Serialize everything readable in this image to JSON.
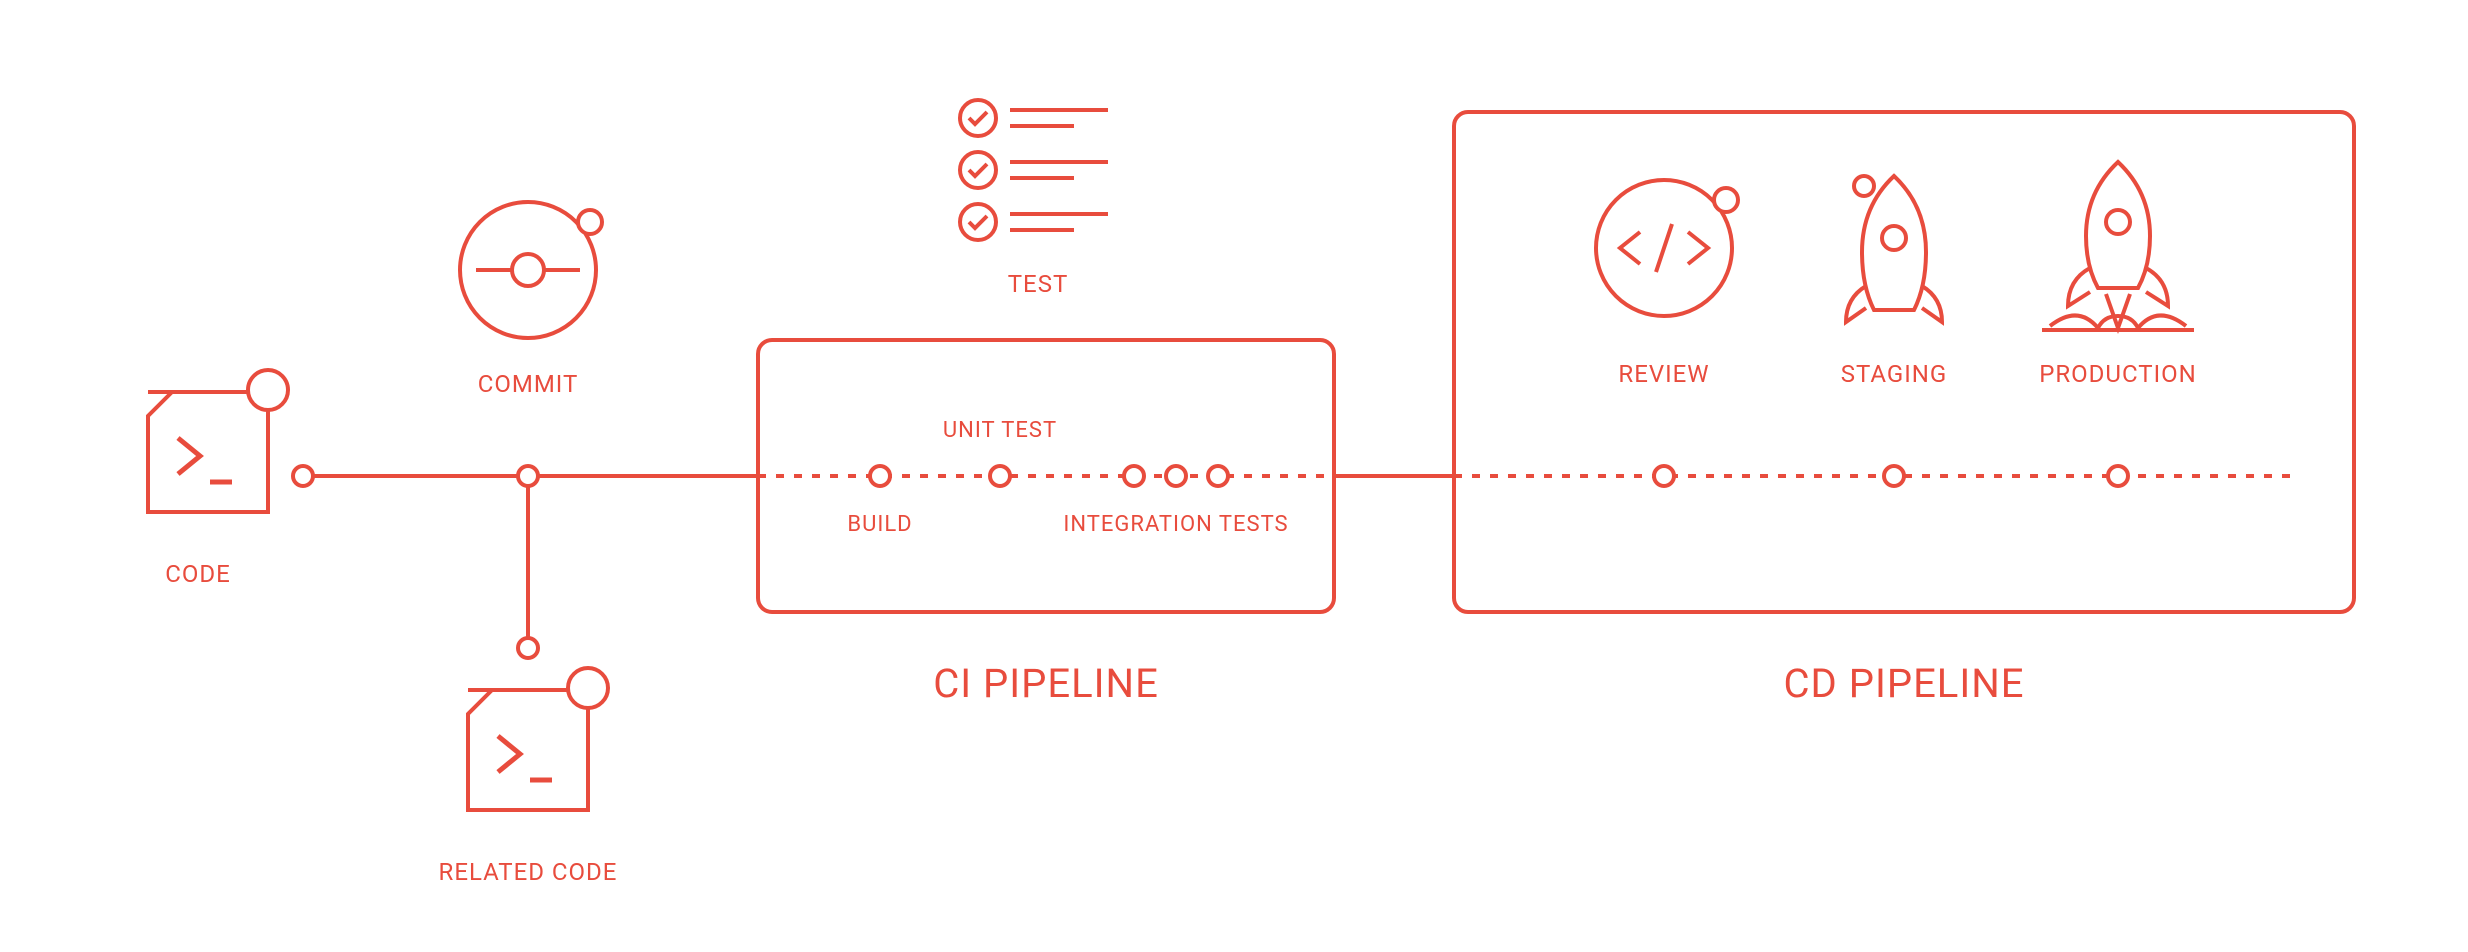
{
  "color": "#e84c3d",
  "labels": {
    "code": "CODE",
    "related_code": "RELATED CODE",
    "commit": "COMMIT",
    "test": "TEST",
    "ci_pipeline_title": "CI PIPELINE",
    "cd_pipeline_title": "CD PIPELINE",
    "build": "BUILD",
    "unit_test": "UNIT TEST",
    "integration_tests": "INTEGRATION TESTS",
    "review": "REVIEW",
    "staging": "STAGING",
    "production": "PRODUCTION"
  }
}
